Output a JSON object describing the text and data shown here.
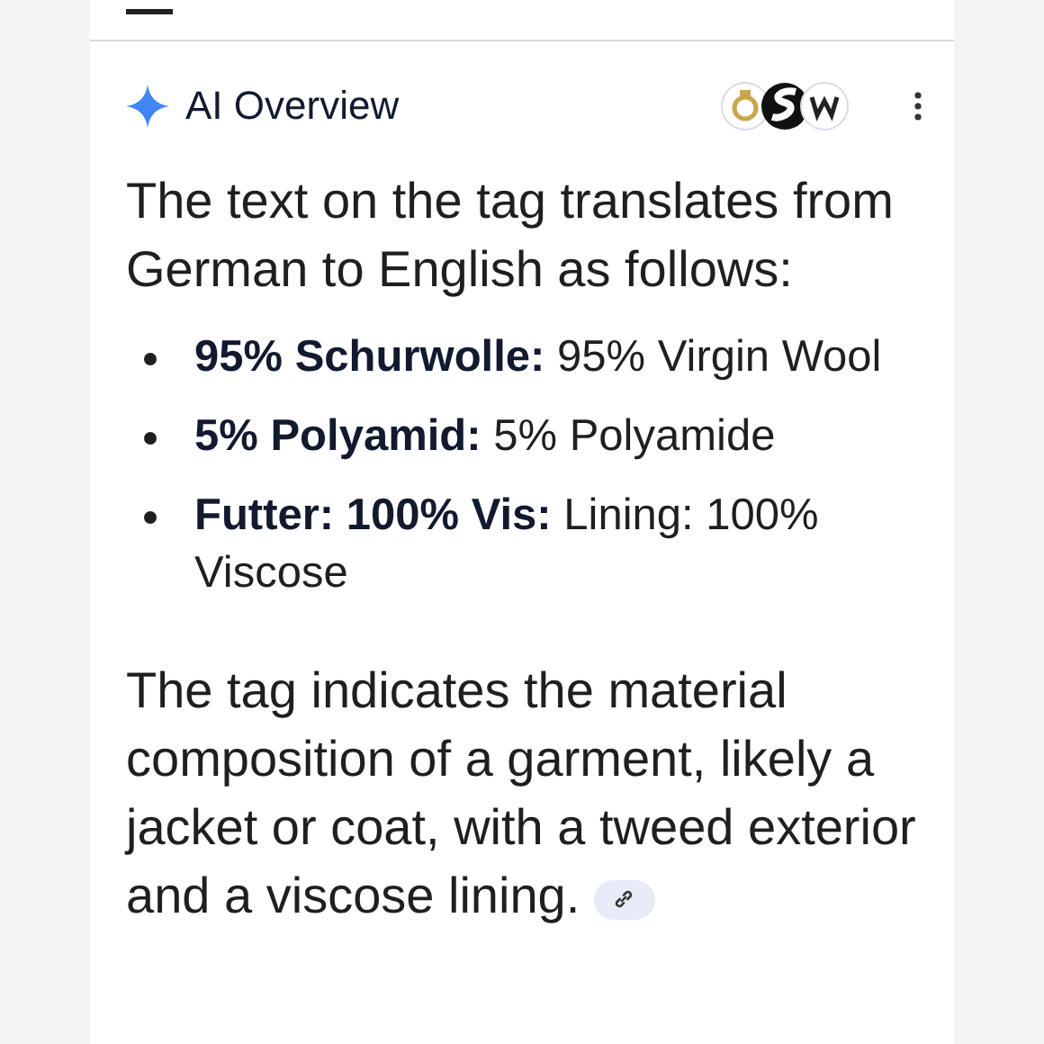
{
  "header": {
    "title": "AI Overview"
  },
  "intro": "The text on the tag translates from German to English as follows:",
  "items": [
    {
      "text": "**95% Schurwolle:** 95% Virgin Wool"
    },
    {
      "text": "**5% Polyamid:** 5% Polyamide"
    },
    {
      "text": "**Futter: 100% Vis:** Lining: 100% Viscose"
    }
  ],
  "summary": "The tag indicates the material composition of a garment, likely a jacket or coat, with a tweed exterior and a viscose lining."
}
